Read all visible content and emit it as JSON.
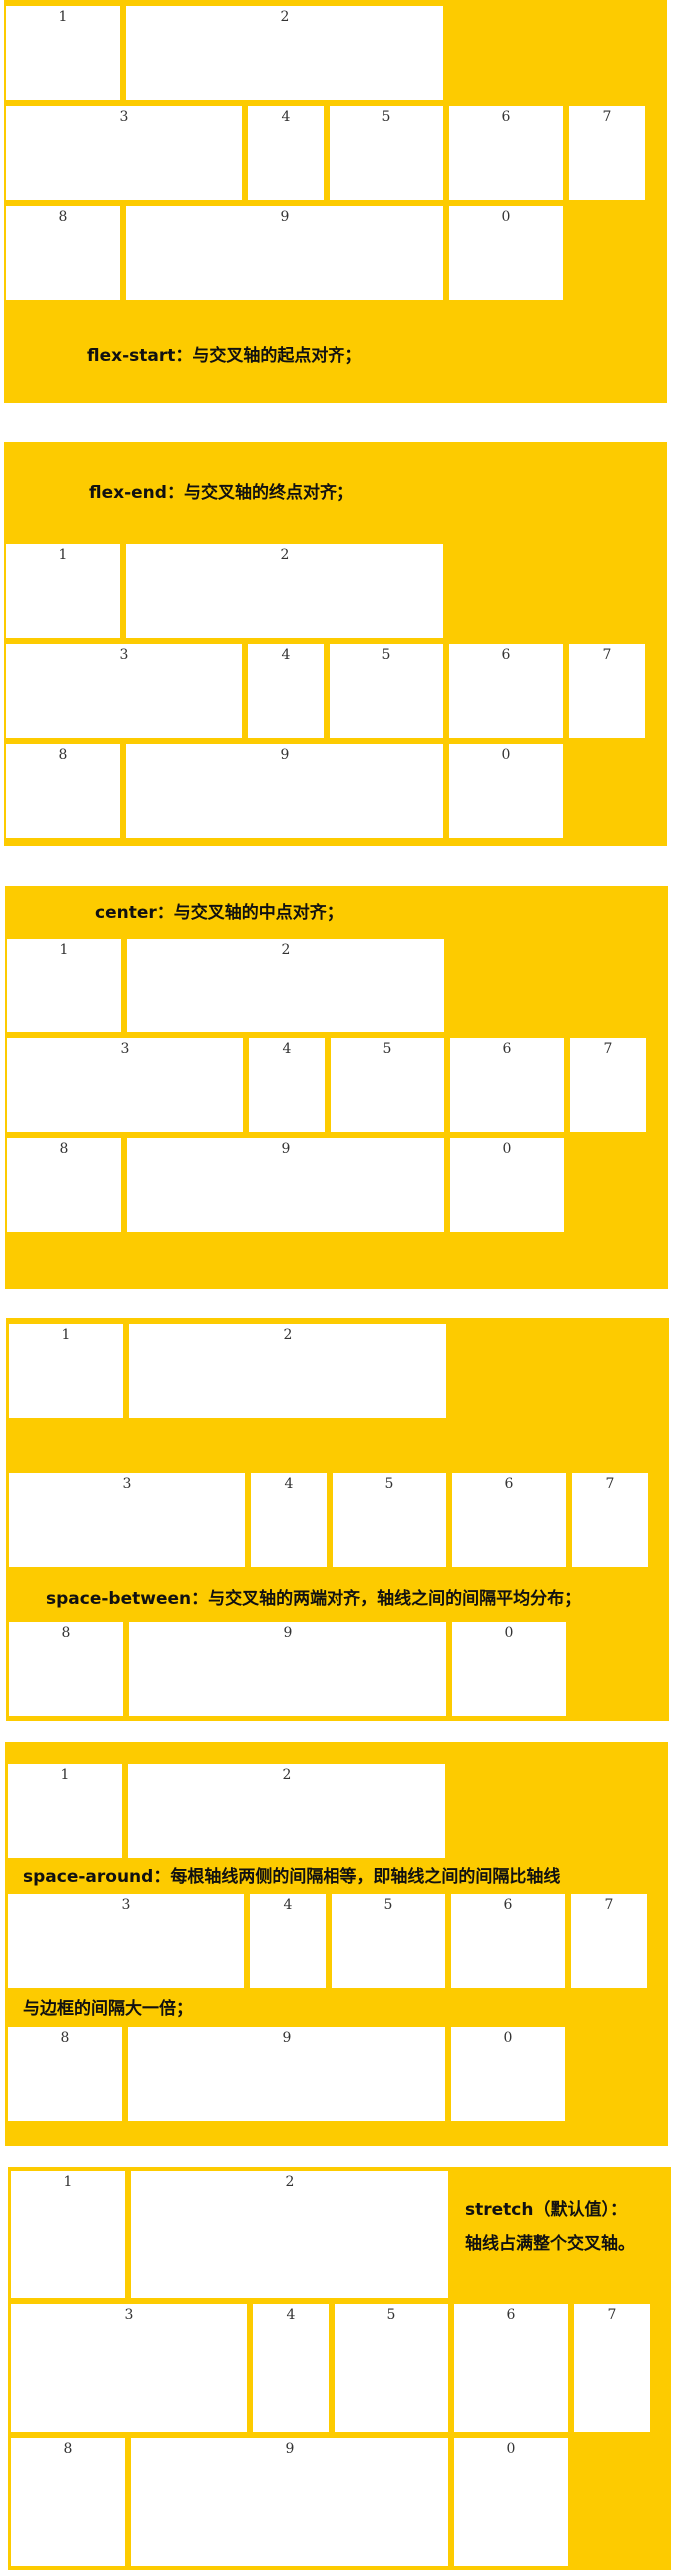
{
  "colors": {
    "panel": "#fdcb00",
    "box": "#ffffff",
    "text": "#111111"
  },
  "labels": [
    "1",
    "2",
    "3",
    "4",
    "5",
    "6",
    "7",
    "8",
    "9",
    "0"
  ],
  "panels": [
    {
      "captions": [
        "flex-start：与交叉轴的起点对齐；"
      ]
    },
    {
      "captions": [
        "flex-end：与交叉轴的终点对齐；"
      ]
    },
    {
      "captions": [
        "center：与交叉轴的中点对齐；"
      ]
    },
    {
      "captions": [
        "space-between：与交叉轴的两端对齐，轴线之间的间隔平均分布；"
      ]
    },
    {
      "captions": [
        "space-around：每根轴线两侧的间隔相等，即轴线之间的间隔比轴线",
        "与边框的间隔大一倍；"
      ]
    },
    {
      "captions": [
        "stretch（默认值）：",
        "轴线占满整个交叉轴。"
      ]
    }
  ]
}
